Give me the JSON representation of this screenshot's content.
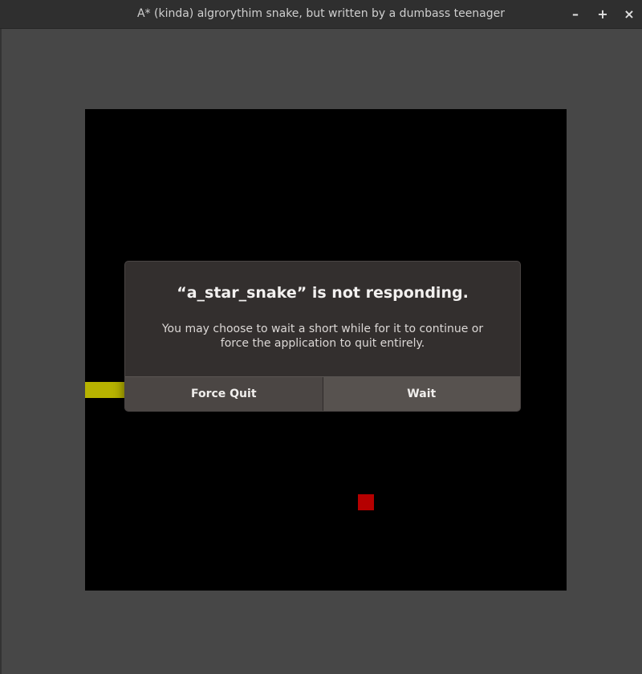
{
  "window": {
    "title": "A* (kinda) algrorythim snake, but written by a dumbass teenager",
    "controls": {
      "minimize": "–",
      "maximize": "+",
      "close": "×"
    }
  },
  "game": {
    "board_color": "#000000",
    "snake_color": "#b7b300",
    "food_color": "#b50000"
  },
  "dialog": {
    "title": "“a_star_snake” is not responding.",
    "body_line1": "You may choose to wait a short while for it to continue or",
    "body_line2": "force the application to quit entirely.",
    "force_quit_label": "Force Quit",
    "wait_label": "Wait"
  }
}
